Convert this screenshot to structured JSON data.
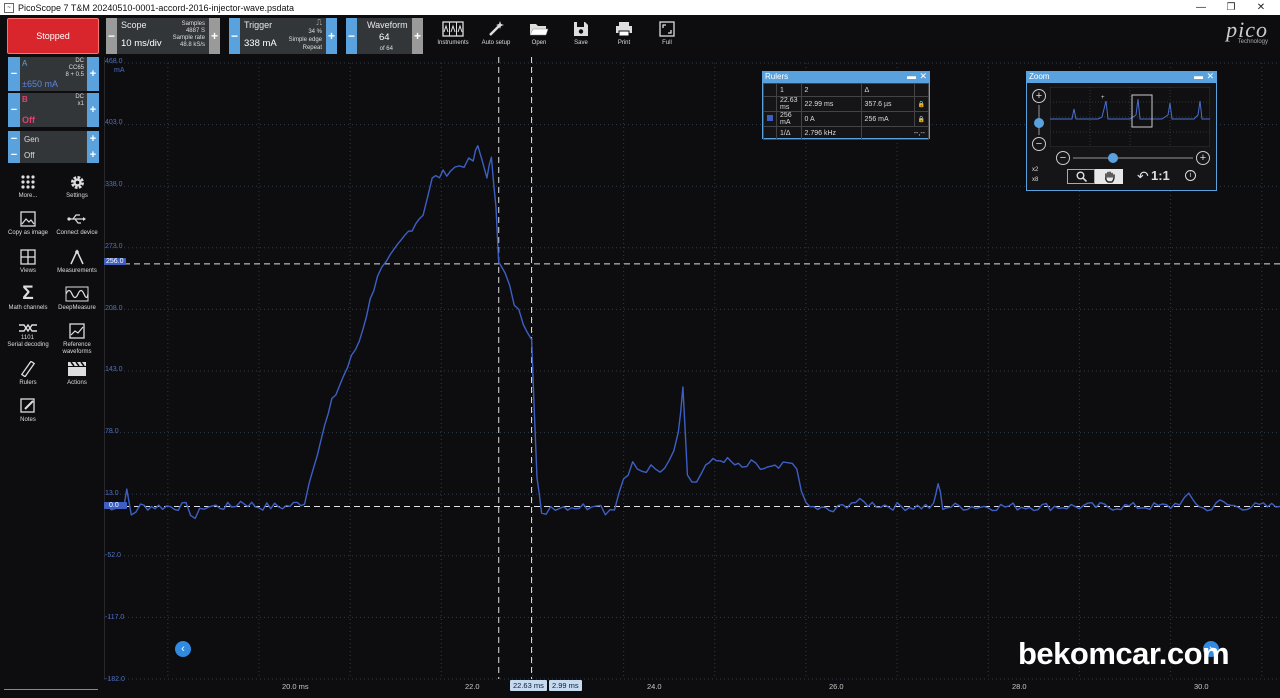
{
  "window": {
    "title": "PicoScope 7 T&M 20240510-0001-accord-2016-injector-wave.psdata",
    "min_icon": "—",
    "restore_icon": "❐",
    "close_icon": "✕"
  },
  "toolbar": {
    "stopped_label": "Stopped",
    "scope": {
      "title": "Scope",
      "value": "10 ms/div",
      "samples_label": "Samples",
      "samples_value": "4887 S",
      "rate_label": "Sample rate",
      "rate_value": "48.8 kS/s"
    },
    "trigger": {
      "title": "Trigger",
      "value": "338 mA",
      "percent": "34 %",
      "mode": "Simple edge",
      "repeat": "Repeat"
    },
    "waveform": {
      "title": "Waveform",
      "value": "64",
      "of": "of 64"
    },
    "tools": [
      {
        "label": "Instruments",
        "icon": "instruments-icon"
      },
      {
        "label": "Auto setup",
        "icon": "wand-icon"
      },
      {
        "label": "Open",
        "icon": "folder-icon"
      },
      {
        "label": "Save",
        "icon": "save-icon"
      },
      {
        "label": "Print",
        "icon": "print-icon"
      },
      {
        "label": "Full",
        "icon": "fullscreen-icon"
      }
    ],
    "logo": {
      "word": "pico",
      "sub": "Technology"
    }
  },
  "channels": {
    "a": {
      "name": "A",
      "range": "±650 mA",
      "coupling": "DC",
      "probe": "CC65",
      "offset": "8 + 0.5"
    },
    "b": {
      "name": "B",
      "state": "Off",
      "coupling": "DC",
      "probe": "x1"
    },
    "gen": {
      "name": "Gen",
      "state": "Off"
    }
  },
  "sidebar": {
    "items": [
      {
        "label": "More...",
        "icon": "grid-dots-icon"
      },
      {
        "label": "Settings",
        "icon": "gear-icon"
      },
      {
        "label": "Copy as image",
        "icon": "image-icon"
      },
      {
        "label": "Connect device",
        "icon": "usb-icon"
      },
      {
        "label": "Views",
        "icon": "views-icon"
      },
      {
        "label": "Measurements",
        "icon": "measure-icon"
      },
      {
        "label": "Math channels",
        "icon": "sigma-icon"
      },
      {
        "label": "DeepMeasure",
        "icon": "wave-icon"
      },
      {
        "label": "Serial decoding",
        "icon": "serial-icon"
      },
      {
        "label": "Reference waveforms",
        "icon": "ref-icon"
      },
      {
        "label": "Rulers",
        "icon": "ruler-icon"
      },
      {
        "label": "Actions",
        "icon": "clapper-icon"
      },
      {
        "label": "Notes",
        "icon": "notes-icon"
      }
    ]
  },
  "plot": {
    "unit": "mA",
    "y_ticks": [
      "468.0",
      "403.0",
      "338.0",
      "273.0",
      "256.0",
      "208.0",
      "143.0",
      "78.0",
      "13.0",
      "0.0",
      "-52.0",
      "-117.0",
      "-182.0"
    ],
    "x_ticks": [
      "20.0 ms",
      "22.0",
      "24.0",
      "26.0",
      "28.0",
      "30.0"
    ],
    "ruler_readout_1": "22.63 ms",
    "ruler_readout_2": "2.99 ms",
    "trace_color": "#3d5fc4"
  },
  "chart_data": {
    "type": "line",
    "x_unit": "ms",
    "y_unit": "mA",
    "xlim": [
      18.3,
      31.2
    ],
    "ylim": [
      -182,
      468
    ],
    "y_ticks": [
      468,
      403,
      338,
      273,
      208,
      143,
      78,
      13,
      -52,
      -117,
      -182
    ],
    "x_ticks": [
      20,
      22,
      24,
      26,
      28,
      30
    ],
    "horizontal_rulers": [
      256,
      0
    ],
    "vertical_rulers": [
      22.63,
      22.99
    ],
    "series": [
      {
        "x": [
          18.3,
          18.5,
          18.55,
          18.6,
          18.7,
          18.9,
          19.2,
          19.3,
          19.4,
          19.7,
          19.8,
          20.0,
          20.3,
          20.5,
          20.6,
          20.8,
          21.1,
          21.3,
          21.4,
          21.6,
          21.8,
          21.9,
          22.1,
          22.2,
          22.35,
          22.4,
          22.5,
          22.55,
          22.6,
          22.63,
          22.7,
          22.8,
          22.9,
          22.99,
          23.05,
          23.1,
          23.2,
          23.3,
          23.6,
          23.7,
          23.8,
          23.9,
          24.0,
          24.1,
          24.2,
          24.3,
          24.4,
          24.5,
          24.6,
          24.65,
          24.7,
          24.8,
          24.9,
          25.1,
          25.3,
          25.4,
          25.5,
          25.7,
          25.8,
          25.9,
          26.0,
          26.3,
          26.4,
          26.5,
          27.0,
          27.4,
          27.45,
          27.5,
          28.0,
          28.5,
          29.0,
          29.5,
          30.0,
          30.1,
          30.2,
          30.4,
          30.5,
          30.7,
          31.2
        ],
        "y": [
          0,
          0,
          15,
          -8,
          0,
          0,
          0,
          -12,
          0,
          0,
          5,
          0,
          0,
          5,
          45,
          110,
          175,
          245,
          256,
          285,
          310,
          345,
          355,
          360,
          365,
          380,
          350,
          365,
          320,
          256,
          245,
          215,
          195,
          180,
          30,
          -10,
          0,
          0,
          0,
          5,
          -5,
          0,
          30,
          45,
          35,
          40,
          35,
          50,
          75,
          130,
          35,
          25,
          45,
          50,
          40,
          45,
          40,
          40,
          45,
          40,
          0,
          -5,
          0,
          5,
          0,
          0,
          25,
          0,
          0,
          0,
          0,
          0,
          0,
          5,
          10,
          -5,
          5,
          0,
          0
        ]
      }
    ]
  },
  "rulers": {
    "title": "Rulers",
    "headers": [
      "1",
      "2",
      "Δ"
    ],
    "row1": [
      "22.63 ms",
      "22.99 ms",
      "357.6 µs"
    ],
    "row2": [
      "256 mA",
      "0 A",
      "256 mA"
    ],
    "freq_label": "1/Δ",
    "freq_value": "2.796 kHz",
    "extra": "--,--"
  },
  "zoom": {
    "title": "Zoom",
    "x2": "x2",
    "x8": "x8",
    "ratio": "1:1"
  },
  "watermark": "bekomcar.com"
}
